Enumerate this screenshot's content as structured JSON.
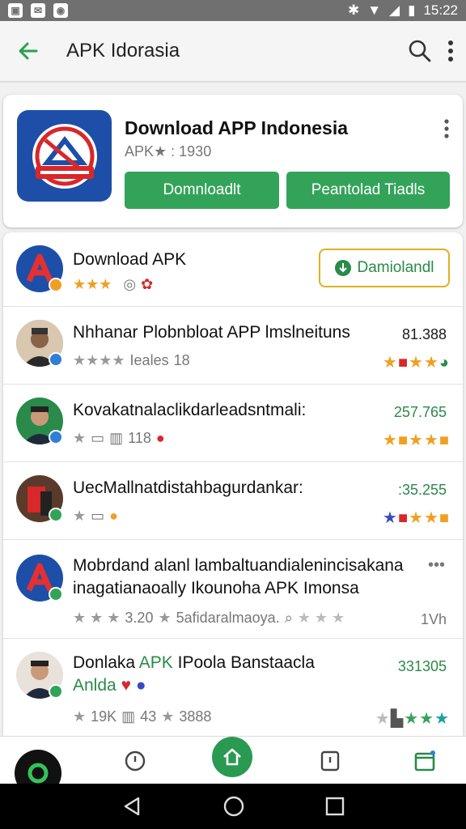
{
  "status": {
    "time": "15:22"
  },
  "appbar": {
    "title": "APK Idorasia"
  },
  "hero": {
    "title": "Download APP Indonesia",
    "meta": "APK★ : 1930",
    "btn_primary": "Domnloadlt",
    "btn_secondary": "Peantolad Tiadls"
  },
  "list": {
    "featured": {
      "title": "Download APK",
      "rating": "★★★",
      "button": "Damiolandl"
    },
    "items": [
      {
        "title": "Nhhanar Plobnbloat APP lmslneituns",
        "sub": "Ieales",
        "sub_num": "18",
        "number": "81.388",
        "number_color": "#777777"
      },
      {
        "title": "Kovakatnalaclikdarleadsntmali:",
        "sub": "118",
        "number": "257.765",
        "number_color": "#2a8a4a"
      },
      {
        "title": "UecMallnatdistahbagurdankar:",
        "sub": "",
        "number": ":35.255",
        "number_color": "#2a8a4a"
      },
      {
        "title": "Mobrdand alanl lambaltuandialenincisakana",
        "title2": "inagatianaoally Ikounoha APK Imonsa",
        "sub": "3.20",
        "sub2": "5afidaralmaoya.",
        "number": "1Vh",
        "number_color": "#777777"
      },
      {
        "title_plain": "Donlaka",
        "title_green": "APK",
        "title_rest": "IPoola Banstaacla",
        "title2": "Anlda",
        "sub": "19K",
        "sub_num": "43",
        "sub2": "3888",
        "number": "331305",
        "number_color": "#2a8a4a"
      }
    ]
  },
  "colors": {
    "green": "#34a35a",
    "blue": "#1d4fa8",
    "accent_yellow": "#e0b020"
  },
  "icons": [
    "back-arrow-icon",
    "search-icon",
    "more-vert-icon",
    "home-icon",
    "history-icon",
    "bookmark-icon",
    "calendar-icon"
  ]
}
